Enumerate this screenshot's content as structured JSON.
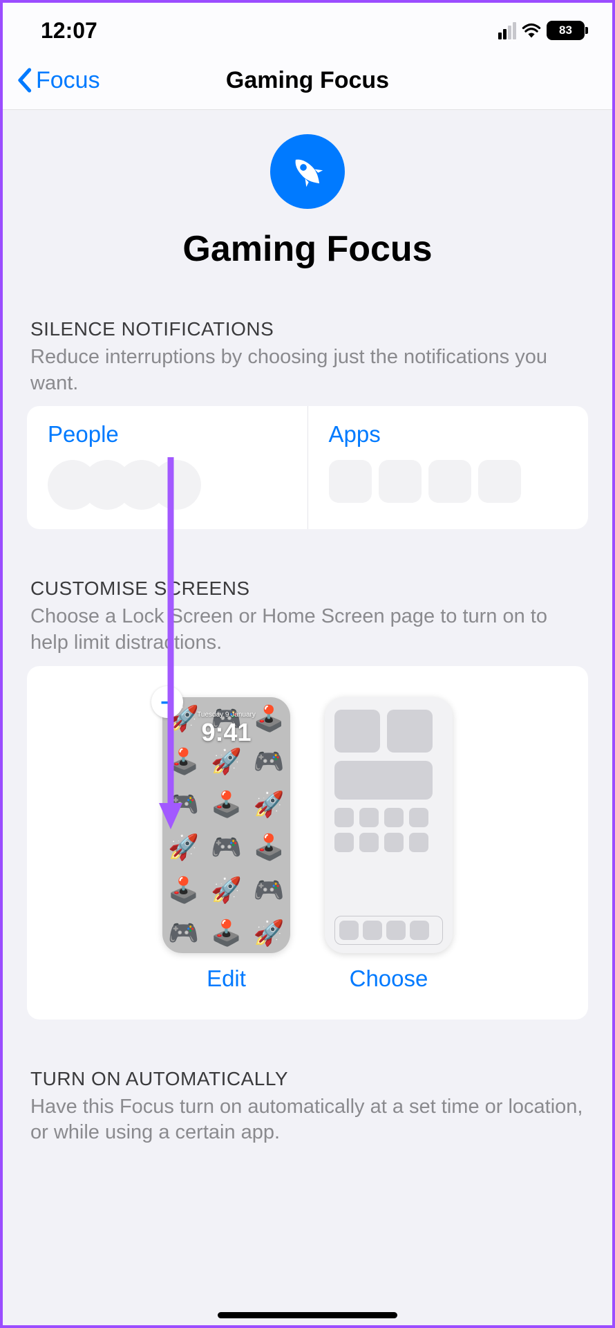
{
  "status": {
    "time": "12:07",
    "battery": "83"
  },
  "nav": {
    "back_label": "Focus",
    "title": "Gaming Focus"
  },
  "hero": {
    "title": "Gaming Focus"
  },
  "sections": {
    "silence": {
      "label": "SILENCE NOTIFICATIONS",
      "desc": "Reduce interruptions by choosing just the notifications you want.",
      "people": "People",
      "apps": "Apps"
    },
    "customise": {
      "label": "CUSTOMISE SCREENS",
      "desc": "Choose a Lock Screen or Home Screen page to turn on to help limit distractions.",
      "edit": "Edit",
      "choose": "Choose",
      "lock_time": "9:41",
      "lock_date": "Tuesday 9 January"
    },
    "auto": {
      "label": "TURN ON AUTOMATICALLY",
      "desc": "Have this Focus turn on automatically at a set time or location, or while using a certain app."
    }
  },
  "annotation": {
    "minus_badge": "–"
  }
}
